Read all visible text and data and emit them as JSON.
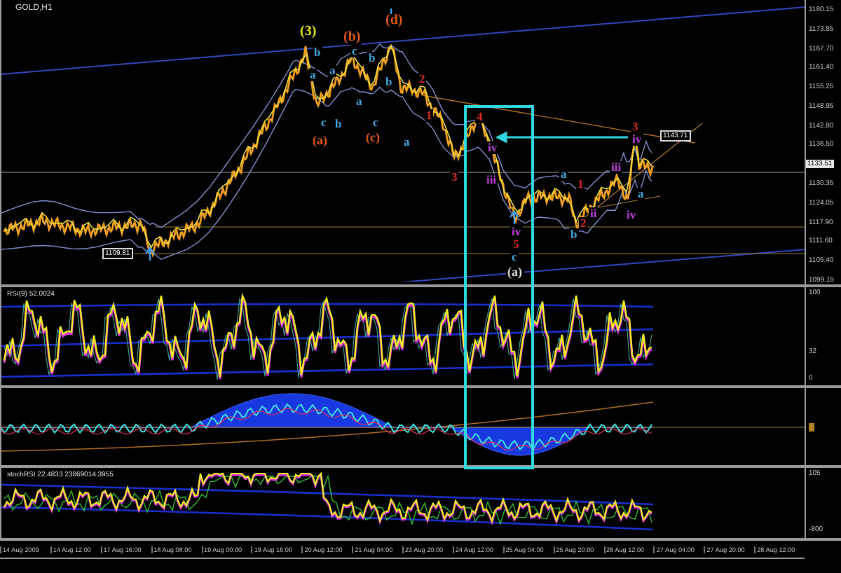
{
  "chart": {
    "title": "GOLD,H1",
    "price_axis": [
      "1180.15",
      "1173.85",
      "1167.70",
      "1161.40",
      "1155.25",
      "1148.95",
      "1142.80",
      "1136.50",
      "1130.35",
      "1124.05",
      "1117.90",
      "1111.60",
      "1105.40",
      "1099.15"
    ],
    "current_price": "1133.51",
    "price_tags": [
      "1109.81",
      "1143.71"
    ],
    "wave_labels": [
      {
        "text": "(3)",
        "color": "#e8e020"
      },
      {
        "text": "(b)",
        "color": "#e05818"
      },
      {
        "text": "(d)",
        "color": "#e05818"
      },
      {
        "text": "(a)",
        "color": "#e05818"
      },
      {
        "text": "(c)",
        "color": "#e05818"
      },
      {
        "text": "b",
        "color": "#40a8e0"
      },
      {
        "text": "a",
        "color": "#40a8e0"
      },
      {
        "text": "c",
        "color": "#40a8e0"
      },
      {
        "text": "b",
        "color": "#40a8e0"
      },
      {
        "text": "a",
        "color": "#40a8e0"
      },
      {
        "text": "c",
        "color": "#40a8e0"
      },
      {
        "text": "b",
        "color": "#40a8e0"
      },
      {
        "text": "a",
        "color": "#40a8e0"
      },
      {
        "text": "c",
        "color": "#40a8e0"
      },
      {
        "text": "b",
        "color": "#40a8e0"
      },
      {
        "text": "a",
        "color": "#40a8e0"
      },
      {
        "text": "2",
        "color": "#e02828"
      },
      {
        "text": "1",
        "color": "#e02828"
      },
      {
        "text": "3",
        "color": "#e02828"
      },
      {
        "text": "4",
        "color": "#e02828"
      },
      {
        "text": "iv",
        "color": "#c040e0"
      },
      {
        "text": "iii",
        "color": "#c040e0"
      },
      {
        "text": "iv",
        "color": "#c040e0"
      },
      {
        "text": "5",
        "color": "#e02828"
      },
      {
        "text": "c",
        "color": "#40a8e0"
      },
      {
        "text": "(a)",
        "color": "#e0e0e0"
      },
      {
        "text": "a",
        "color": "#40a8e0"
      },
      {
        "text": "b",
        "color": "#40a8e0"
      },
      {
        "text": "1",
        "color": "#e02828"
      },
      {
        "text": "2",
        "color": "#e02828"
      },
      {
        "text": "ii",
        "color": "#c040e0"
      },
      {
        "text": "iii",
        "color": "#c040e0"
      },
      {
        "text": "iv",
        "color": "#c040e0"
      },
      {
        "text": "a",
        "color": "#40a8e0"
      },
      {
        "text": "3",
        "color": "#e02828"
      },
      {
        "text": "iv",
        "color": "#c040e0"
      }
    ]
  },
  "rsi_panel": {
    "label": "RSI(9) 52.0024",
    "axis": [
      "100",
      "32",
      "0"
    ]
  },
  "stoch_panel": {
    "label": "stochRSI 22.4833 23869014.3955",
    "axis": [
      "105",
      "-800"
    ]
  },
  "time_axis": [
    "14 Aug 2009",
    "14 Aug 12:00",
    "17 Aug 16:00",
    "18 Aug 08:00",
    "19 Aug 00:00",
    "19 Aug 16:00",
    "20 Aug 12:00",
    "21 Aug 04:00",
    "23 Aug 20:00",
    "24 Aug 12:00",
    "25 Aug 04:00",
    "25 Aug 20:00",
    "26 Aug 12:00",
    "27 Aug 04:00",
    "27 Aug 20:00",
    "28 Aug 12:00"
  ]
}
